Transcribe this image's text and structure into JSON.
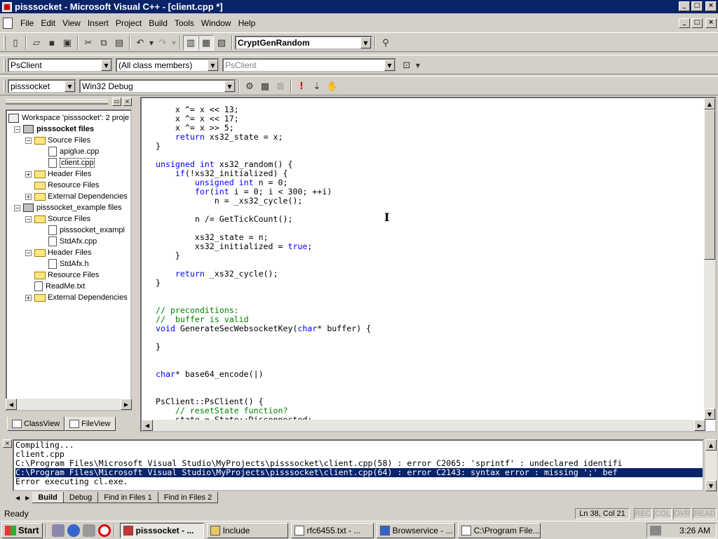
{
  "window": {
    "title": "pisssocket - Microsoft Visual C++ - [client.cpp *]"
  },
  "menu": [
    "File",
    "Edit",
    "View",
    "Insert",
    "Project",
    "Build",
    "Tools",
    "Window",
    "Help"
  ],
  "toolbar": {
    "find_combo": "CryptGenRandom",
    "class_combo": "PsClient",
    "filter_combo": "(All class members)",
    "member_combo": "PsClient",
    "project_combo": "pisssocket",
    "config_combo": "Win32 Debug"
  },
  "workspace": {
    "tree": [
      {
        "label": "Workspace 'pisssocket': 2 proje",
        "level": 0,
        "icon": "workspace-icon",
        "expander": ""
      },
      {
        "label": "pisssocket files",
        "level": 1,
        "icon": "project-icon",
        "expander": "−",
        "bold": true
      },
      {
        "label": "Source Files",
        "level": 2,
        "icon": "folder-icon",
        "expander": "−"
      },
      {
        "label": "apiglue.cpp",
        "level": 3,
        "icon": "file-icon",
        "expander": ""
      },
      {
        "label": "client.cpp",
        "level": 3,
        "icon": "file-icon",
        "expander": "",
        "selected": true
      },
      {
        "label": "Header Files",
        "level": 2,
        "icon": "folder-icon",
        "expander": "+"
      },
      {
        "label": "Resource Files",
        "level": 2,
        "icon": "folder-icon",
        "expander": ""
      },
      {
        "label": "External Dependencies",
        "level": 2,
        "icon": "folder-icon",
        "expander": "+"
      },
      {
        "label": "pisssocket_example files",
        "level": 1,
        "icon": "project-icon",
        "expander": "−"
      },
      {
        "label": "Source Files",
        "level": 2,
        "icon": "folder-icon",
        "expander": "−"
      },
      {
        "label": "pisssocket_exampl",
        "level": 3,
        "icon": "file-icon",
        "expander": ""
      },
      {
        "label": "StdAfx.cpp",
        "level": 3,
        "icon": "file-icon",
        "expander": ""
      },
      {
        "label": "Header Files",
        "level": 2,
        "icon": "folder-icon",
        "expander": "−"
      },
      {
        "label": "StdAfx.h",
        "level": 3,
        "icon": "file-icon",
        "expander": ""
      },
      {
        "label": "Resource Files",
        "level": 2,
        "icon": "folder-icon",
        "expander": ""
      },
      {
        "label": "ReadMe.txt",
        "level": 2,
        "icon": "file-icon",
        "expander": ""
      },
      {
        "label": "External Dependencies",
        "level": 2,
        "icon": "folder-icon",
        "expander": "+"
      }
    ],
    "tabs": [
      "ClassView",
      "FileView"
    ]
  },
  "editor": {
    "lines": [
      [
        [
          "    x ^= x << 13;",
          ""
        ]
      ],
      [
        [
          "    x ^= x << 17;",
          ""
        ]
      ],
      [
        [
          "    x ^= x >> 5;",
          ""
        ]
      ],
      [
        [
          "    ",
          ""
        ],
        [
          "return",
          "kw"
        ],
        [
          " xs32_state = x;",
          ""
        ]
      ],
      [
        [
          "}",
          ""
        ]
      ],
      [
        [
          "",
          ""
        ]
      ],
      [
        [
          "unsigned int",
          "kw"
        ],
        [
          " xs32_random() {",
          ""
        ]
      ],
      [
        [
          "    ",
          ""
        ],
        [
          "if",
          "kw"
        ],
        [
          "(!xs32_initialized) {",
          ""
        ]
      ],
      [
        [
          "        ",
          ""
        ],
        [
          "unsigned int",
          "kw"
        ],
        [
          " n = 0;",
          ""
        ]
      ],
      [
        [
          "        ",
          ""
        ],
        [
          "for",
          "kw"
        ],
        [
          "(",
          ""
        ],
        [
          "int",
          "kw"
        ],
        [
          " i = 0; i < 300; ++i)",
          ""
        ]
      ],
      [
        [
          "            n = _xs32_cycle();",
          ""
        ]
      ],
      [
        [
          "",
          ""
        ]
      ],
      [
        [
          "        n /= GetTickCount();",
          ""
        ]
      ],
      [
        [
          "",
          ""
        ]
      ],
      [
        [
          "        xs32_state = n;",
          ""
        ]
      ],
      [
        [
          "        xs32_initialized = ",
          ""
        ],
        [
          "true",
          "kw"
        ],
        [
          ";",
          ""
        ]
      ],
      [
        [
          "    }",
          ""
        ]
      ],
      [
        [
          "",
          ""
        ]
      ],
      [
        [
          "    ",
          ""
        ],
        [
          "return",
          "kw"
        ],
        [
          " _xs32_cycle();",
          ""
        ]
      ],
      [
        [
          "}",
          ""
        ]
      ],
      [
        [
          "",
          ""
        ]
      ],
      [
        [
          "",
          ""
        ]
      ],
      [
        [
          "// preconditions:",
          "cm"
        ]
      ],
      [
        [
          "//  buffer is valid",
          "cm"
        ]
      ],
      [
        [
          "void",
          "kw"
        ],
        [
          " GenerateSecWebsocketKey(",
          ""
        ],
        [
          "char",
          "kw"
        ],
        [
          "* buffer) {",
          ""
        ]
      ],
      [
        [
          "",
          ""
        ]
      ],
      [
        [
          "}",
          ""
        ]
      ],
      [
        [
          "",
          ""
        ]
      ],
      [
        [
          "",
          ""
        ]
      ],
      [
        [
          "char",
          "kw"
        ],
        [
          "* base64_encode(|)",
          ""
        ]
      ],
      [
        [
          "",
          ""
        ]
      ],
      [
        [
          "",
          ""
        ]
      ],
      [
        [
          "PsClient::PsClient() {",
          ""
        ]
      ],
      [
        [
          "    // resetState function?",
          "cm"
        ]
      ],
      [
        [
          "    state = State::Disconnected;",
          ""
        ]
      ]
    ]
  },
  "output": {
    "lines": [
      "Compiling...",
      "client.cpp",
      "C:\\Program Files\\Microsoft Visual Studio\\MyProjects\\pisssocket\\client.cpp(58) : error C2065: 'sprintf' : undeclared identifi",
      "C:\\Program Files\\Microsoft Visual Studio\\MyProjects\\pisssocket\\client.cpp(64) : error C2143: syntax error : missing ';' bef",
      "Error executing cl.exe."
    ],
    "highlighted_line": 3,
    "tabs": [
      "Build",
      "Debug",
      "Find in Files 1",
      "Find in Files 2"
    ]
  },
  "status": {
    "text": "Ready",
    "position": "Ln 38, Col 21",
    "indicators": [
      "REC",
      "COL",
      "OVR",
      "READ"
    ]
  },
  "taskbar": {
    "start": "Start",
    "tasks": [
      "pisssocket - ...",
      "Include",
      "rfc6455.txt - ...",
      "Browservice - ...",
      "C:\\Program File..."
    ],
    "active_task": 0,
    "clock": "3:26 AM"
  },
  "colors": {
    "title_bg": "#0a246a",
    "keyword": "#0000ff",
    "comment": "#008000",
    "face": "#d4d0c8"
  }
}
